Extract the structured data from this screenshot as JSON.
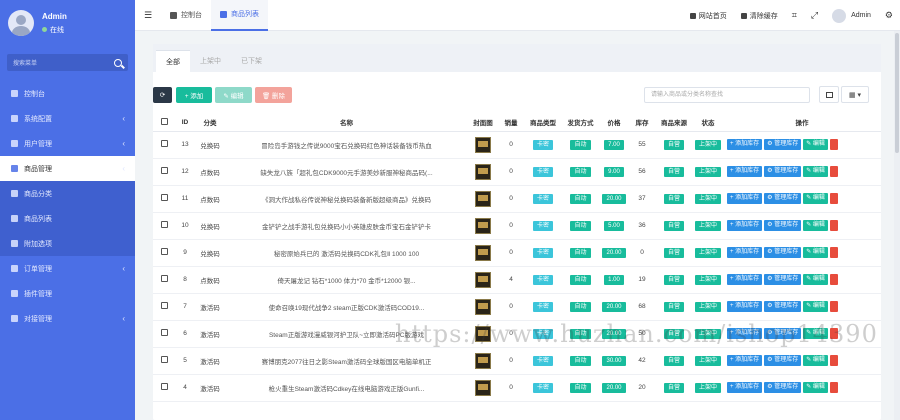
{
  "sidebar": {
    "user": {
      "name": "Admin",
      "status": "在线"
    },
    "search_placeholder": "搜索菜单",
    "items": [
      {
        "label": "控制台",
        "icon": "dashboard-icon",
        "chevron": false
      },
      {
        "label": "系统配置",
        "icon": "gear-icon",
        "chevron": true
      },
      {
        "label": "用户管理",
        "icon": "user-icon",
        "chevron": true
      },
      {
        "label": "商品管理",
        "icon": "cart-icon",
        "chevron": true,
        "active": true
      },
      {
        "label": "商品分类",
        "icon": "tag-icon",
        "sub": true
      },
      {
        "label": "商品列表",
        "icon": "list-icon",
        "sub": true
      },
      {
        "label": "附加选项",
        "icon": "bookmark-icon",
        "sub": true
      },
      {
        "label": "订单管理",
        "icon": "order-icon",
        "chevron": true
      },
      {
        "label": "插件管理",
        "icon": "plugin-icon",
        "chevron": false
      },
      {
        "label": "对接管理",
        "icon": "link-icon",
        "chevron": true
      }
    ]
  },
  "topbar": {
    "tabs": [
      {
        "label": "控制台",
        "icon": "dashboard-icon"
      },
      {
        "label": "商品列表",
        "icon": "list-icon",
        "active": true
      }
    ],
    "right": {
      "home": "网站首页",
      "clear_cache": "清除缓存",
      "user": "Admin"
    }
  },
  "panel": {
    "tabs": [
      "全部",
      "上架中",
      "已下架"
    ],
    "buttons": {
      "add": "+ 添加",
      "edit": "✎ 编辑",
      "delete": "🗑 删除"
    },
    "search_placeholder": "请输入商品或分类名称查找",
    "columns": [
      "",
      "ID",
      "分类",
      "名称",
      "封面图",
      "销量",
      "商品类型",
      "发货方式",
      "价格",
      "库存",
      "商品来源",
      "状态",
      "操作"
    ],
    "rows": [
      {
        "id": "13",
        "category": "兑换码",
        "name": "冒险岛手游钱之传说9000宝石兑换码红色神话装备钱币热血",
        "sales": "0",
        "type": "卡密",
        "ship": "自动",
        "price": "7.00",
        "stock": "55",
        "source": "自营",
        "status": "上架中"
      },
      {
        "id": "12",
        "category": "点数码",
        "name": "缺失龙八族「超礼包CDK9000元手游美妙新服神秘商品码(...",
        "sales": "0",
        "type": "卡密",
        "ship": "自动",
        "price": "9.00",
        "stock": "56",
        "source": "自营",
        "status": "上架中"
      },
      {
        "id": "11",
        "category": "点数码",
        "name": "《洞大作战私谷传说神秘兑换码装备新版超级商品》兑换码",
        "sales": "0",
        "type": "卡密",
        "ship": "自动",
        "price": "20.00",
        "stock": "37",
        "source": "自营",
        "status": "上架中"
      },
      {
        "id": "10",
        "category": "兑换码",
        "name": "金铲铲之战手游礼包兑换码小小英雄皮肤金币宝石金铲铲卡",
        "sales": "0",
        "type": "卡密",
        "ship": "自动",
        "price": "5.00",
        "stock": "36",
        "source": "自营",
        "status": "上架中"
      },
      {
        "id": "9",
        "category": "兑换码",
        "name": "秘密原始兵已的 激活码兑换码CDK礼包Ⅱ 1000 100",
        "sales": "0",
        "type": "卡密",
        "ship": "自动",
        "price": "20.00",
        "stock": "0",
        "source": "自营",
        "status": "上架中"
      },
      {
        "id": "8",
        "category": "点数码",
        "name": "倚天屠龙记 钻石*1000 体力*70 金币*12000 银...",
        "sales": "4",
        "type": "卡密",
        "ship": "自动",
        "price": "1.00",
        "stock": "19",
        "source": "自营",
        "status": "上架中"
      },
      {
        "id": "7",
        "category": "激活码",
        "name": "使命召唤19现代战争2 steam正版CDK激活码COD19...",
        "sales": "0",
        "type": "卡密",
        "ship": "自动",
        "price": "20.00",
        "stock": "68",
        "source": "自营",
        "status": "上架中"
      },
      {
        "id": "6",
        "category": "激活码",
        "name": "Steam正版游戏漫威银河护卫队~立即激活码PC版游戏",
        "sales": "0",
        "type": "卡密",
        "ship": "自动",
        "price": "20.00",
        "stock": "50",
        "source": "自营",
        "status": "上架中"
      },
      {
        "id": "5",
        "category": "激活码",
        "name": "赛博朋克2077往日之影Steam激活码全球版国区电脑单机正",
        "sales": "0",
        "type": "卡密",
        "ship": "自动",
        "price": "30.00",
        "stock": "42",
        "source": "自营",
        "status": "上架中"
      },
      {
        "id": "4",
        "category": "激活码",
        "name": "枪火重生Steam激活码Cdkey在线电脑游戏正版Gunfi...",
        "sales": "0",
        "type": "卡密",
        "ship": "自动",
        "price": "20.00",
        "stock": "20",
        "source": "自营",
        "status": "上架中"
      }
    ],
    "actions": {
      "add_stock": "+ 添加库存",
      "manage_stock": "⚙ 管理库存",
      "edit": "✎ 编辑"
    }
  },
  "watermark": "https://www.huzhan.com/ishop14390"
}
